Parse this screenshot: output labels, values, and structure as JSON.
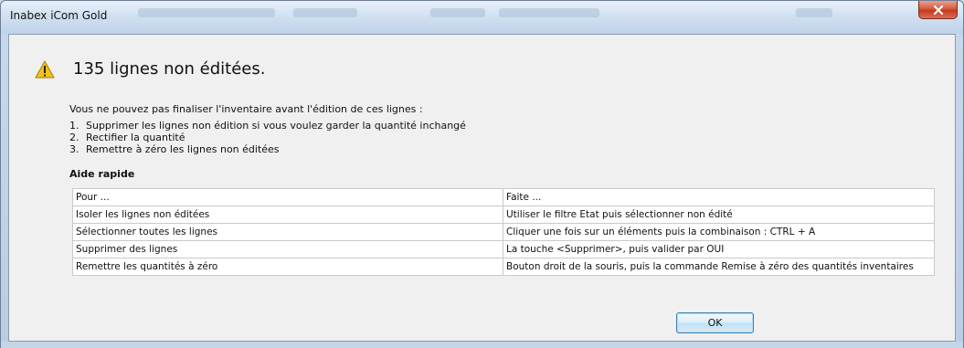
{
  "window": {
    "title": "Inabex iCom Gold",
    "close_icon": "close-icon"
  },
  "dialog": {
    "icon": "warning-icon",
    "heading": "135 lignes non éditées.",
    "intro": "Vous ne pouvez pas finaliser l'inventaire avant l'édition de ces lignes :",
    "steps": [
      {
        "num": "1.",
        "text": "Supprimer les lignes non édition si vous voulez garder la quantité inchangé"
      },
      {
        "num": "2.",
        "text": "Rectifier la quantité"
      },
      {
        "num": "3.",
        "text": "Remettre à zéro les lignes non éditées"
      }
    ],
    "help_title": "Aide rapide",
    "help_table": {
      "header": [
        "Pour ...",
        "Faite ..."
      ],
      "rows": [
        [
          "Isoler les lignes non éditées",
          "Utiliser le filtre Etat puis sélectionner non édité"
        ],
        [
          "Sélectionner toutes les lignes",
          "Cliquer une fois sur un éléments puis la combinaison : CTRL + A"
        ],
        [
          "Supprimer des lignes",
          "La touche <Supprimer>, puis valider par OUI"
        ],
        [
          "Remettre les quantités à zéro",
          "Bouton droit de la souris, puis la commande Remise à zéro des quantités inventaires"
        ]
      ]
    },
    "ok_label": "OK"
  },
  "colors": {
    "warning": "#f2c21a",
    "close_button": "#c43a1c",
    "ok_border": "#3c7fb1"
  }
}
